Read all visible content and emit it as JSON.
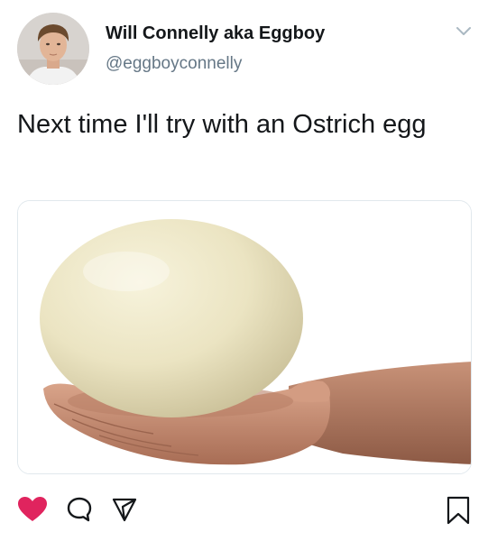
{
  "tweet": {
    "author": {
      "display_name": "Will Connelly aka Eggboy",
      "handle": "@eggboyconnelly",
      "avatar_icon": "profile-photo"
    },
    "text": "Next time I'll try with an Ostrich egg",
    "media": {
      "icon": "ostrich-egg-in-hand-photo"
    },
    "menu_icon": "chevron-down-icon",
    "actions": {
      "like_icon": "heart-icon",
      "like_color": "#e0245e",
      "reply_icon": "comment-icon",
      "share_icon": "send-icon",
      "save_icon": "bookmark-icon"
    }
  },
  "colors": {
    "text": "#14171a",
    "secondary_text": "#657786",
    "like": "#e0245e",
    "icon": "#14171a"
  }
}
